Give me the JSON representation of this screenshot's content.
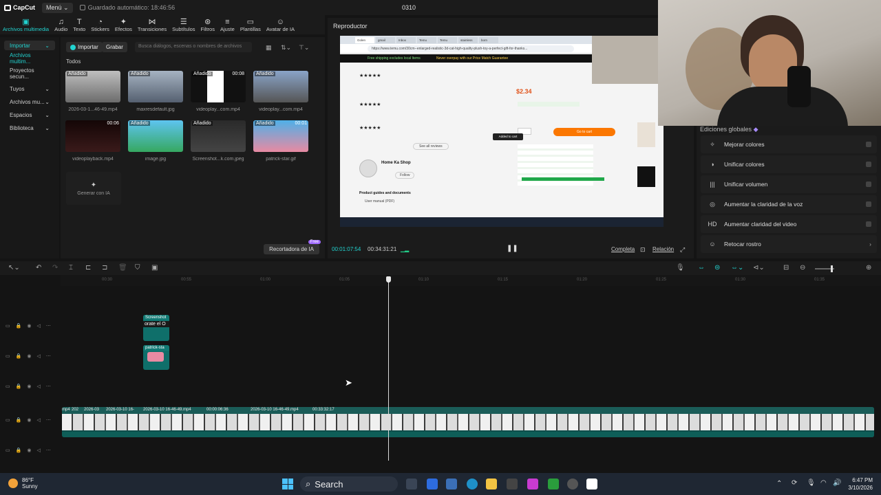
{
  "titlebar": {
    "app_name": "CapCut",
    "menu_label": "Menú",
    "autosave": "Guardado automático: 18:46:56",
    "project_name": "0310"
  },
  "toolbar": [
    {
      "label": "Archivos multimedia",
      "icon": "media-icon"
    },
    {
      "label": "Audio",
      "icon": "audio-icon"
    },
    {
      "label": "Texto",
      "icon": "text-icon"
    },
    {
      "label": "Stickers",
      "icon": "sticker-icon"
    },
    {
      "label": "Efectos",
      "icon": "effects-icon"
    },
    {
      "label": "Transiciones",
      "icon": "transitions-icon"
    },
    {
      "label": "Subtítulos",
      "icon": "subtitles-icon"
    },
    {
      "label": "Filtros",
      "icon": "filters-icon"
    },
    {
      "label": "Ajuste",
      "icon": "adjust-icon"
    },
    {
      "label": "Plantillas",
      "icon": "templates-icon"
    },
    {
      "label": "Avatar de IA",
      "icon": "avatar-icon"
    }
  ],
  "leftnav": [
    "Importar",
    "Archivos multim...",
    "Proyectos secun...",
    "Tuyos",
    "Archivos mu...",
    "Espacios",
    "Biblioteca"
  ],
  "media": {
    "import_label": "Importar",
    "record_label": "Grabar",
    "search_placeholder": "Busca diálogos, escenas o nombres de archivos",
    "filter_label": "Todos",
    "items": [
      {
        "badge": "Añadido",
        "dur": "",
        "caption": "2026-03-1...46-49.mp4"
      },
      {
        "badge": "Añadido",
        "dur": "",
        "caption": "maxresdefault.jpg"
      },
      {
        "badge": "Añadido",
        "dur": "00:08",
        "caption": "videoplay...com.mp4"
      },
      {
        "badge": "Añadido",
        "dur": "",
        "caption": "videoplay...com.mp4"
      },
      {
        "badge": "",
        "dur": "00:06",
        "caption": "videoplayback.mp4"
      },
      {
        "badge": "Añadido",
        "dur": "",
        "caption": "image.jpg"
      },
      {
        "badge": "Añadido",
        "dur": "",
        "caption": "Screenshot...k.com.jpeg"
      },
      {
        "badge": "Añadido",
        "dur": "00:01",
        "caption": "patrick-star.gif"
      }
    ],
    "generate_label": "Generar con IA",
    "cutout_label": "Recortadora de IA",
    "free_badge": "Free"
  },
  "player": {
    "title": "Reproductor",
    "time_current": "00:01:07:54",
    "time_total": "00:34:31:21",
    "complete_label": "Completa",
    "ratio_label": "Relación"
  },
  "global_edits": {
    "title": "Ediciones globales",
    "items": [
      {
        "label": "Mejorar colores",
        "icon": "sparkle-icon"
      },
      {
        "label": "Unificar colores",
        "icon": "color-match-icon"
      },
      {
        "label": "Unificar volumen",
        "icon": "volume-bars-icon"
      },
      {
        "label": "Aumentar la claridad de la voz",
        "icon": "voice-icon"
      },
      {
        "label": "Aumentar claridad del video",
        "icon": "hd-icon"
      },
      {
        "label": "Retocar rostro",
        "icon": "face-icon"
      }
    ]
  },
  "timeline": {
    "ruler_ticks": [
      "00:30",
      "00:55",
      "01:00",
      "01:05",
      "01:10",
      "01:15",
      "01:20",
      "01:25",
      "01:30",
      "01:35"
    ],
    "clip_labels": [
      "Screenshot",
      "orate el O",
      "patrick-sta"
    ],
    "main_clip_labels": [
      "mp4",
      "202",
      "2026-03",
      "2026-03-10 16-",
      "2026-03-10 16-46-49.mp4",
      "00:00:06:36",
      "2026-03-10 16-46-49.mp4",
      "00:33:32:17"
    ]
  },
  "taskbar": {
    "temp": "86°F",
    "weather": "Sunny",
    "search_label": "Search",
    "time": "6:47 PM",
    "date": "3/10/2026"
  },
  "browser": {
    "tabs": [
      "Golen",
      "gmail",
      "Inbox",
      "Temu",
      "Temu",
      "stainless",
      "born"
    ],
    "url": "https://www.temu.com/30cm--enlarged-realistic-3d-cat-high-quality-plush-toy-a-perfect-gift-for-thanks...",
    "banner_left": "Free shipping excludes local Items",
    "banner_right": "Never overpay with our Price Match Guarantee",
    "shop_name": "Home Ka Shop",
    "follow": "Follow",
    "see_all": "See all reviews",
    "price": "$2.34",
    "add_to_cart": "Go to cart",
    "added": "Added to cart",
    "product_guides": "Product guides and documents",
    "user_manual": "User manual (PDF)"
  }
}
